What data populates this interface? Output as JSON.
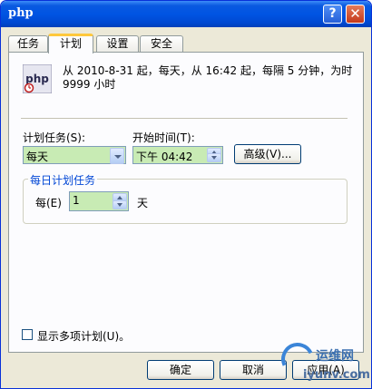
{
  "window": {
    "title": "php"
  },
  "titlebar": {
    "help": "?",
    "close": "✕"
  },
  "tabs": [
    {
      "label": "任务"
    },
    {
      "label": "计划"
    },
    {
      "label": "设置"
    },
    {
      "label": "安全"
    }
  ],
  "summary": {
    "text": "从 2010-8-31 起，每天，从 16:42 起，每隔 5 分钟，为时 9999 小时"
  },
  "logo": {
    "text": "php"
  },
  "schedule": {
    "task_label": "计划任务(S):",
    "task_value": "每天",
    "time_label": "开始时间(T):",
    "time_value": "下午 04:42",
    "advanced_label": "高级(V)..."
  },
  "daily": {
    "group_title": "每日计划任务",
    "every_label": "每(E)",
    "every_value": "1",
    "unit": "天"
  },
  "multi": {
    "label": "显示多项计划(U)。"
  },
  "buttons": {
    "ok": "确定",
    "cancel": "取消",
    "apply": "应用(A)"
  },
  "watermark": {
    "line1": "运维网",
    "line2": "iyunv.com"
  },
  "colors": {
    "title_blue": "#0054e3",
    "field_green": "#c8ebb4",
    "group_title": "#0046d5"
  }
}
